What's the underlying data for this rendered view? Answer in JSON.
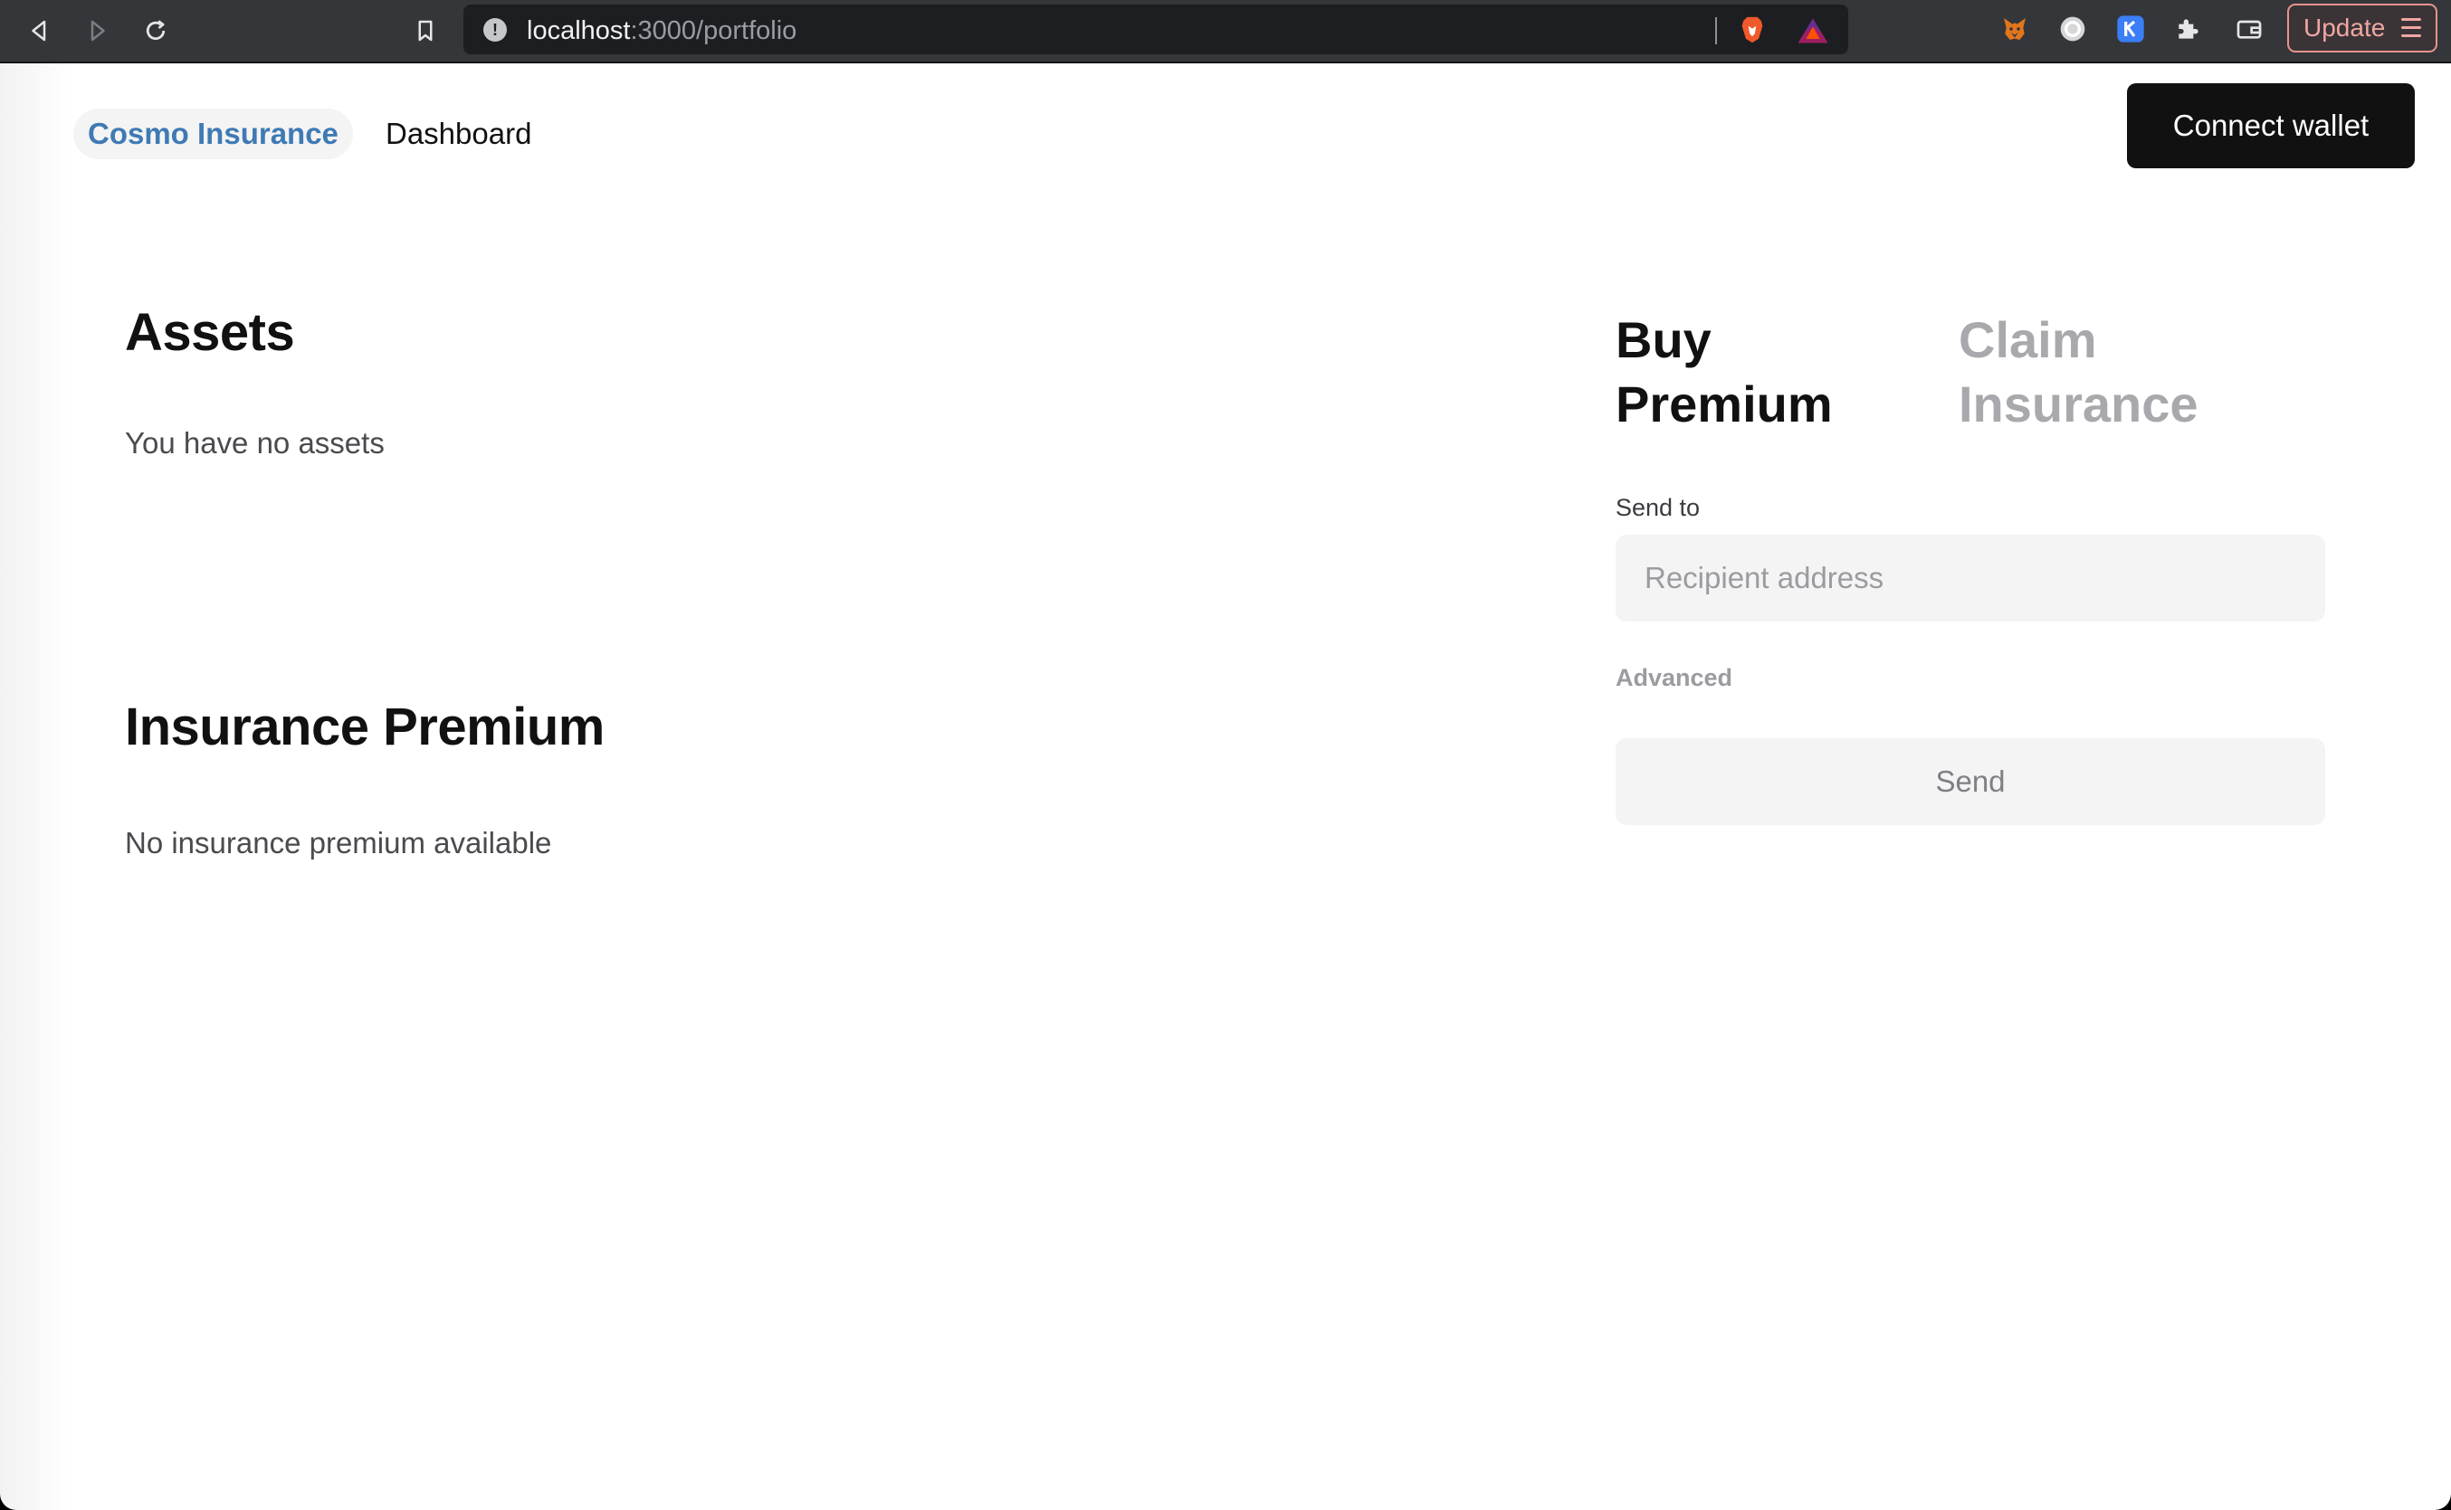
{
  "browser": {
    "url_host": "localhost",
    "url_path": ":3000/portfolio",
    "update_label": "Update",
    "icons": [
      "back-icon",
      "forward-icon",
      "reload-icon",
      "bookmark-icon",
      "site-info-icon",
      "brave-shields-icon",
      "brave-rewards-icon",
      "metamask-icon",
      "extension-c-icon",
      "extension-k-icon",
      "extensions-puzzle-icon",
      "wallet-icon",
      "menu-icon"
    ]
  },
  "header": {
    "brand": "Cosmo Insurance",
    "nav_link": "Dashboard",
    "connect_wallet": "Connect wallet"
  },
  "assets": {
    "title": "Assets",
    "empty_text": "You have no assets"
  },
  "premium": {
    "title": "Insurance Premium",
    "empty_text": "No insurance premium available"
  },
  "form": {
    "tabs": [
      {
        "label_line1": "Buy",
        "label_line2": "Premium",
        "active": true
      },
      {
        "label_line1": "Claim",
        "label_line2": "Insurance",
        "active": false
      }
    ],
    "send_to_label": "Send to",
    "recipient_placeholder": "Recipient address",
    "advanced_label": "Advanced",
    "send_label": "Send"
  },
  "colors": {
    "brand_blue": "#3f7ab4",
    "update_accent": "#f0a7a2"
  }
}
